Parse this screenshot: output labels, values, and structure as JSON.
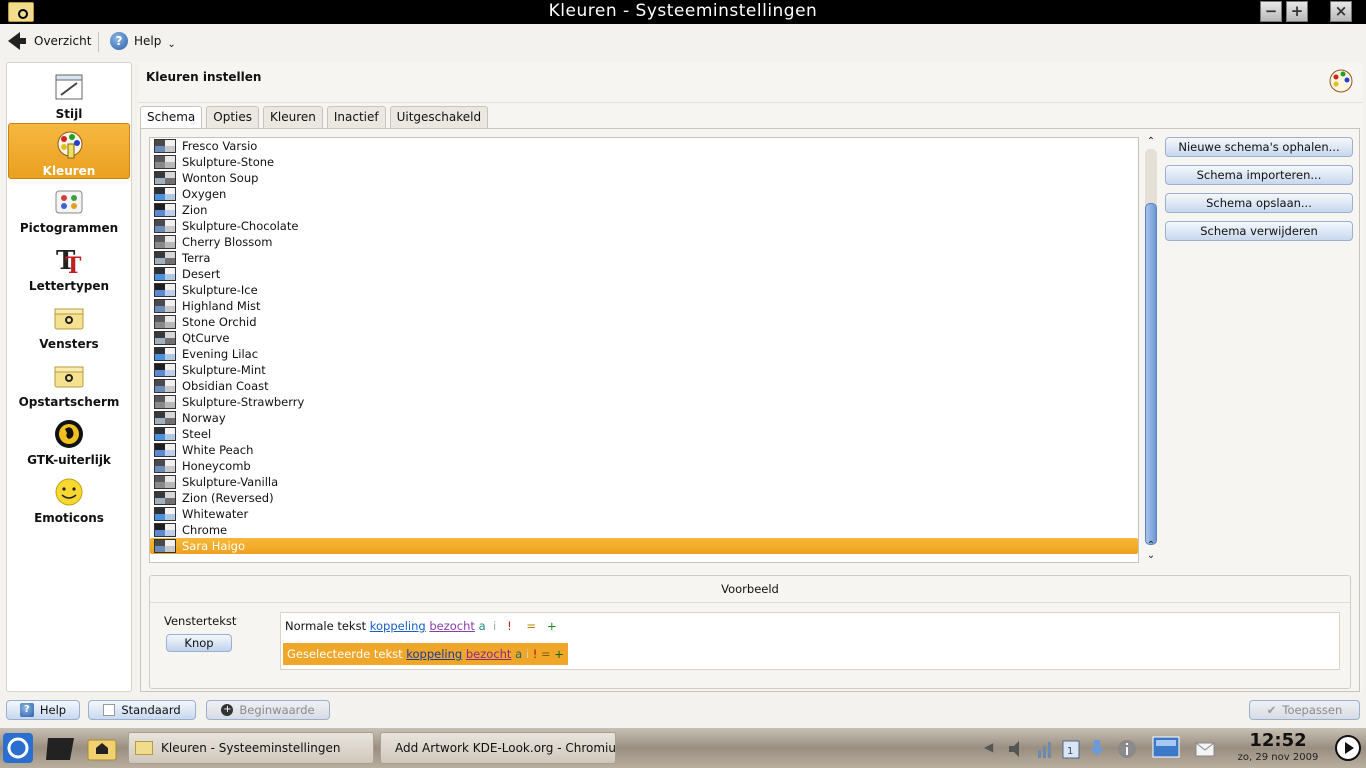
{
  "window": {
    "title": "Kleuren - Systeeminstellingen"
  },
  "toolbar": {
    "back_label": "Overzicht",
    "help_label": "Help"
  },
  "sidebar": {
    "items": [
      {
        "label": "Stijl",
        "icon": "style-icon"
      },
      {
        "label": "Kleuren",
        "icon": "colors-icon",
        "active": true
      },
      {
        "label": "Pictogrammen",
        "icon": "icons-icon"
      },
      {
        "label": "Lettertypen",
        "icon": "fonts-icon"
      },
      {
        "label": "Vensters",
        "icon": "windows-icon"
      },
      {
        "label": "Opstartscherm",
        "icon": "splash-icon"
      },
      {
        "label": "GTK-uiterlijk",
        "icon": "gtk-icon"
      },
      {
        "label": "Emoticons",
        "icon": "emoticons-icon"
      }
    ]
  },
  "main": {
    "title": "Kleuren instellen",
    "tabs": [
      "Schema",
      "Opties",
      "Kleuren",
      "Inactief",
      "Uitgeschakeld"
    ],
    "active_tab": "Schema",
    "schemes": [
      "Fresco Varsio",
      "Skulpture-Stone",
      "Wonton Soup",
      "Oxygen",
      "Zion",
      "Skulpture-Chocolate",
      "Cherry Blossom",
      "Terra",
      "Desert",
      "Skulpture-Ice",
      "Highland Mist",
      "Stone Orchid",
      "QtCurve",
      "Evening Lilac",
      "Skulpture-Mint",
      "Obsidian Coast",
      "Skulpture-Strawberry",
      "Norway",
      "Steel",
      "White Peach",
      "Honeycomb",
      "Skulpture-Vanilla",
      "Zion (Reversed)",
      "Whitewater",
      "Chrome",
      "Sara Haigo"
    ],
    "selected_scheme": "Sara Haigo",
    "buttons": {
      "get_new": "Nieuwe schema's ophalen...",
      "import": "Schema importeren...",
      "save": "Schema opslaan...",
      "remove": "Schema verwijderen"
    },
    "preview": {
      "title": "Voorbeeld",
      "window_text": "Venstertekst",
      "button_label": "Knop",
      "normal_text": "Normale tekst",
      "selected_text": "Geselecteerde tekst",
      "link": "koppeling",
      "visited": "bezocht",
      "a": "a",
      "i": "i",
      "excl": "!",
      "eq": "=",
      "plus": "+"
    }
  },
  "bottom": {
    "help": "Help",
    "default": "Standaard",
    "reset": "Beginwaarde",
    "apply": "Toepassen"
  },
  "taskbar": {
    "tasks": [
      "Kleuren - Systeeminstellingen",
      "Add Artwork KDE-Look.org - Chromium"
    ],
    "time": "12:52",
    "date": "zo, 29 nov 2009"
  },
  "colors": {
    "accent": "#eea220",
    "link": "#1a5fc8",
    "visited": "#8a3ea8"
  }
}
